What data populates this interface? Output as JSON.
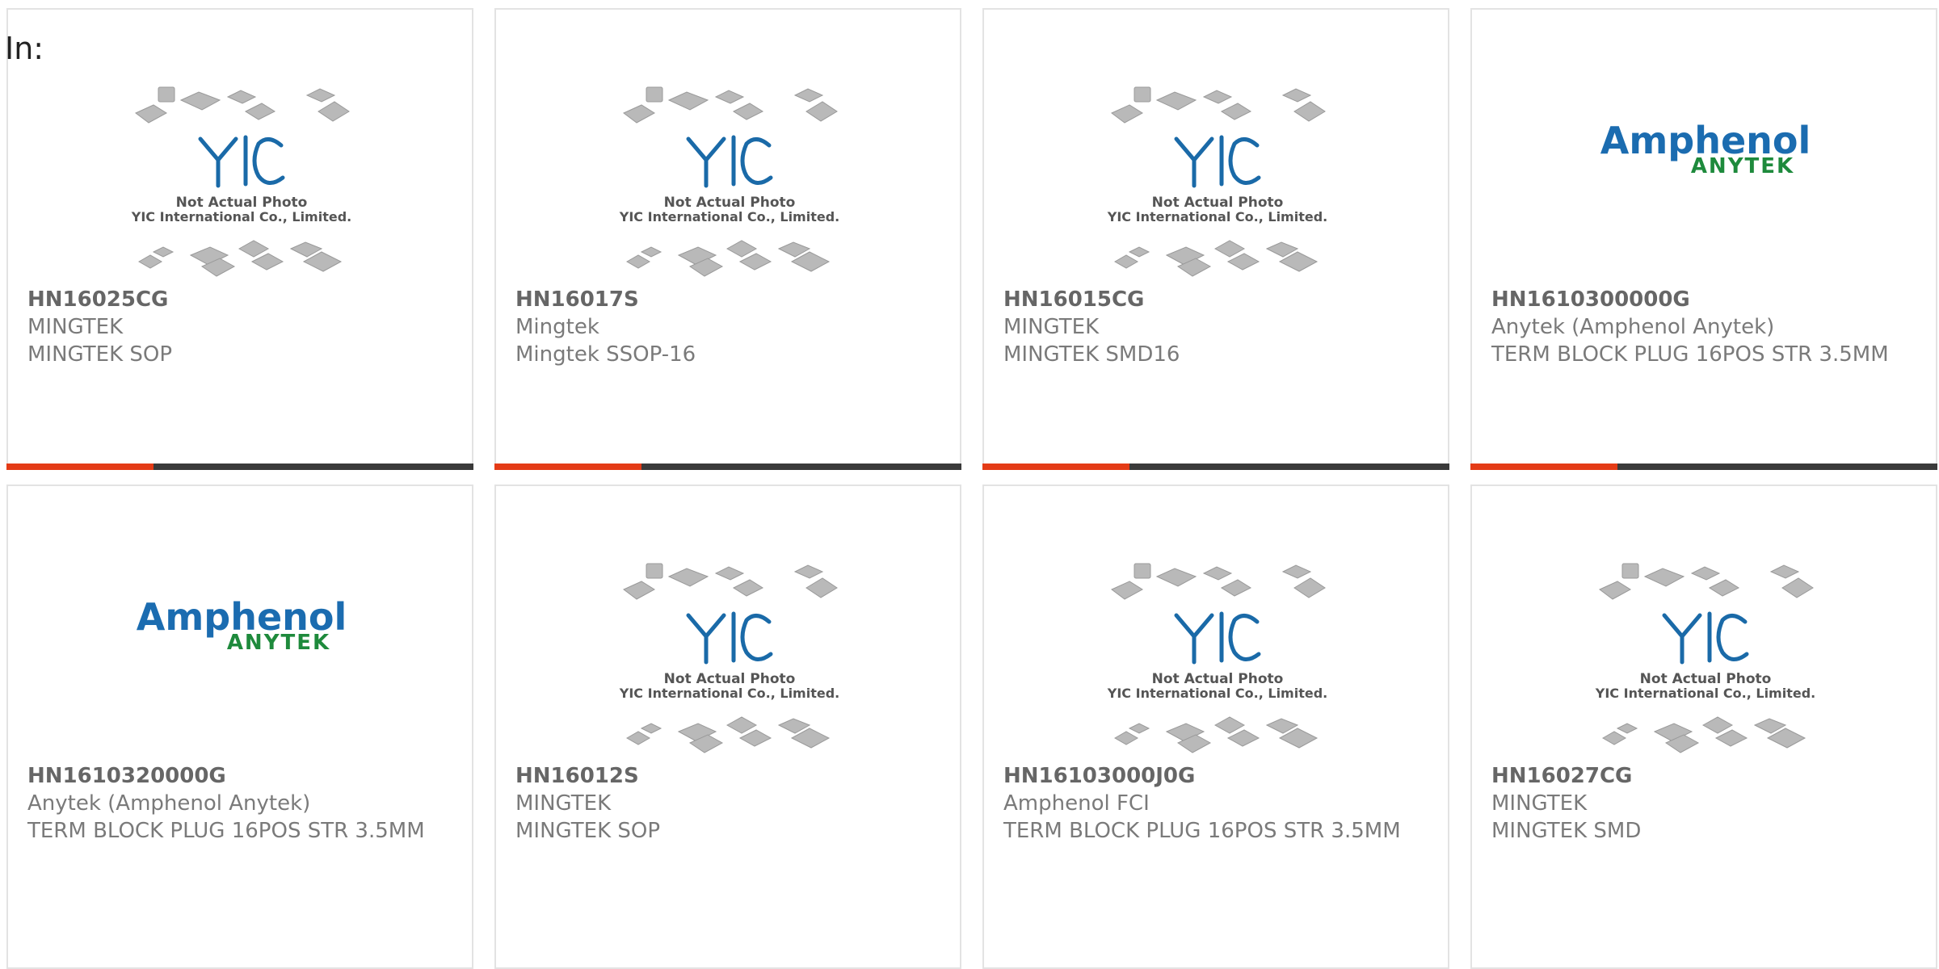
{
  "header": {
    "label": "In:"
  },
  "placeholder": {
    "brand": "YIC",
    "line1": "Not Actual Photo",
    "line2": "YIC International Co., Limited."
  },
  "amphenol": {
    "top": "Amphenol",
    "bottom": "ANYTEK"
  },
  "colors": {
    "accent": "#e43b16",
    "bar": "#3a3a3a",
    "yic_blue": "#1a6aa8",
    "amphenol_blue": "#1b6cb0",
    "anytek_green": "#1e8a3c"
  },
  "products": [
    {
      "part": "HN16025CG",
      "maker": "MINGTEK",
      "desc": "MINGTEK SOP",
      "image": "yic-placeholder"
    },
    {
      "part": "HN16017S",
      "maker": "Mingtek",
      "desc": "Mingtek SSOP-16",
      "image": "yic-placeholder"
    },
    {
      "part": "HN16015CG",
      "maker": "MINGTEK",
      "desc": "MINGTEK SMD16",
      "image": "yic-placeholder"
    },
    {
      "part": "HN1610300000G",
      "maker": "Anytek (Amphenol Anytek)",
      "desc": "TERM BLOCK PLUG 16POS STR 3.5MM",
      "image": "amphenol-anytek-logo"
    },
    {
      "part": "HN1610320000G",
      "maker": "Anytek (Amphenol Anytek)",
      "desc": "TERM BLOCK PLUG 16POS STR 3.5MM",
      "image": "amphenol-anytek-logo"
    },
    {
      "part": "HN16012S",
      "maker": "MINGTEK",
      "desc": "MINGTEK SOP",
      "image": "yic-placeholder"
    },
    {
      "part": "HN16103000J0G",
      "maker": "Amphenol FCI",
      "desc": "TERM BLOCK PLUG 16POS STR 3.5MM",
      "image": "yic-placeholder"
    },
    {
      "part": "HN16027CG",
      "maker": "MINGTEK",
      "desc": "MINGTEK SMD",
      "image": "yic-placeholder"
    }
  ]
}
